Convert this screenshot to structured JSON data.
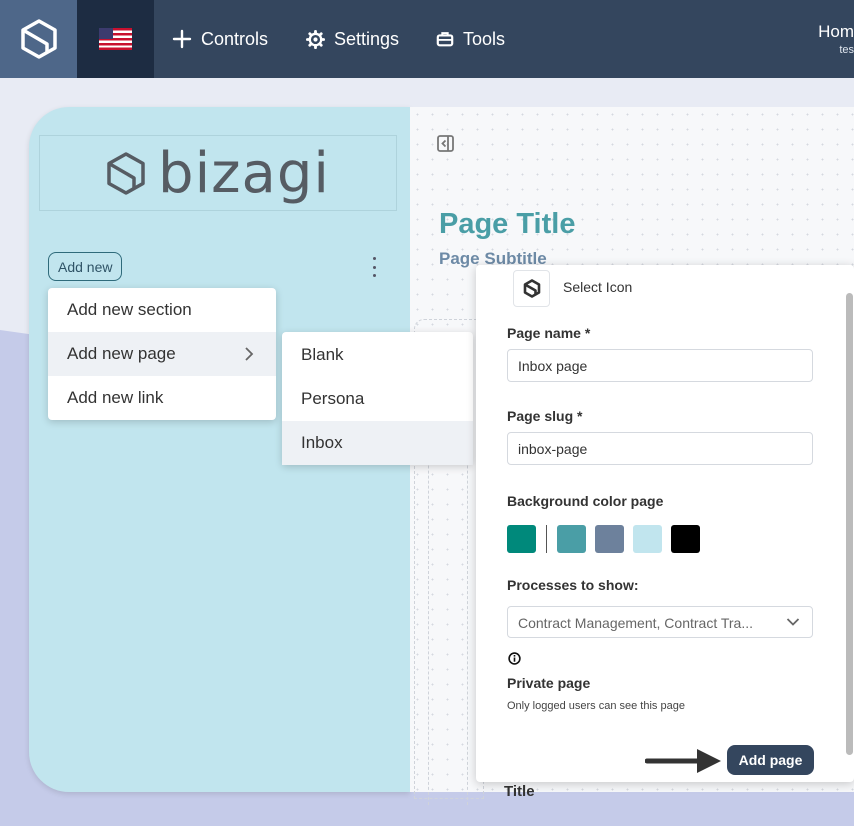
{
  "topbar": {
    "nav": [
      {
        "label": "Controls",
        "icon": "plus-icon"
      },
      {
        "label": "Settings",
        "icon": "gear-icon"
      },
      {
        "label": "Tools",
        "icon": "toolbox-icon"
      }
    ],
    "right_title": "Hom",
    "right_user": "tes"
  },
  "sidebar": {
    "brand": "bizagi",
    "add_new_label": "Add new"
  },
  "add_menu": {
    "items": [
      "Add new section",
      "Add new page",
      "Add new link"
    ]
  },
  "page_submenu": {
    "items": [
      "Blank",
      "Persona",
      "Inbox"
    ]
  },
  "canvas": {
    "page_title": "Page Title",
    "page_subtitle": "Page Subtitle",
    "title_hint": "Title"
  },
  "panel": {
    "select_icon_label": "Select Icon",
    "page_name_label": "Page name *",
    "page_name_value": "Inbox page",
    "page_slug_label": "Page slug *",
    "page_slug_value": "inbox-page",
    "bg_color_label": "Background color page",
    "colors": [
      "#00897b",
      "#4a9ea6",
      "#6d819c",
      "#c1e5ee",
      "#000000"
    ],
    "processes_label": "Processes to show:",
    "processes_value": "Contract Management, Contract Tra...",
    "private_label": "Private page",
    "private_help": "Only logged users can see this page",
    "add_page_label": "Add page"
  },
  "colors": {
    "topbar": "#34465e",
    "sidebar": "#c1e5ee",
    "accent_title": "#4a9ea6",
    "primary_button": "#34465e"
  }
}
